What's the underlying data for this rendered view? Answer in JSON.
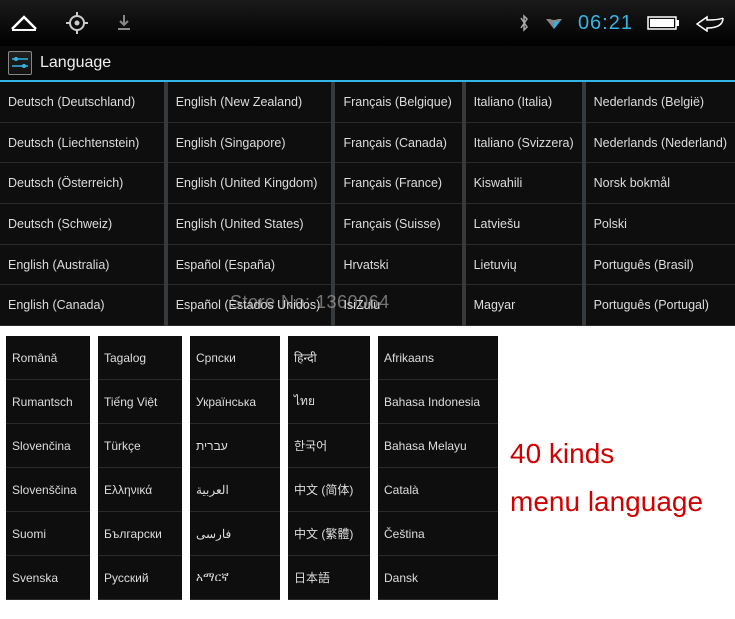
{
  "statusbar": {
    "clock": "06:21"
  },
  "header": {
    "title": "Language"
  },
  "topColumns": [
    [
      "Deutsch (Deutschland)",
      "Deutsch (Liechtenstein)",
      "Deutsch (Österreich)",
      "Deutsch (Schweiz)",
      "English (Australia)",
      "English (Canada)"
    ],
    [
      "English (New Zealand)",
      "English (Singapore)",
      "English (United Kingdom)",
      "English (United States)",
      "Español (España)",
      "Español (Estados Unidos)"
    ],
    [
      "Français (Belgique)",
      "Français (Canada)",
      "Français (France)",
      "Français (Suisse)",
      "Hrvatski",
      "IsiZulu"
    ],
    [
      "Italiano (Italia)",
      "Italiano (Svizzera)",
      "Kiswahili",
      "Latviešu",
      "Lietuvių",
      "Magyar"
    ],
    [
      "Nederlands (België)",
      "Nederlands (Nederland)",
      "Norsk bokmål",
      "Polski",
      "Português (Brasil)",
      "Português (Portugal)"
    ]
  ],
  "bottomColumns": [
    [
      "Română",
      "Rumantsch",
      "Slovenčina",
      "Slovenščina",
      "Suomi",
      "Svenska"
    ],
    [
      "Tagalog",
      "Tiếng Việt",
      "Türkçe",
      "Ελληνικά",
      "Български",
      "Русский"
    ],
    [
      "Српски",
      "Українська",
      "עברית",
      "العربية",
      "فارسی",
      "አማርኛ"
    ],
    [
      "हिन्दी",
      "ไทย",
      "한국어",
      "中文 (简体)",
      "中文 (繁體)",
      "日本語"
    ],
    [
      "Afrikaans",
      "Bahasa Indonesia",
      "Bahasa Melayu",
      "Català",
      "Čeština",
      "Dansk"
    ]
  ],
  "caption": {
    "line1": "40 kinds",
    "line2": "menu language"
  },
  "watermark": "Store No: 1360064"
}
